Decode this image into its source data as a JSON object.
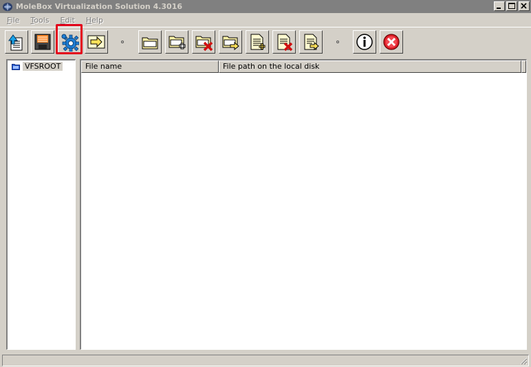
{
  "window": {
    "title": "MoleBox Virtualization Solution 4.3016"
  },
  "menu": {
    "items": [
      {
        "first": "F",
        "rest": "ile"
      },
      {
        "first": "T",
        "rest": "ools"
      },
      {
        "first": "E",
        "rest": "dit"
      },
      {
        "first": "H",
        "rest": "elp"
      }
    ]
  },
  "toolbar": {
    "buttons": [
      "open-project",
      "save-project",
      "settings",
      "build",
      "folder",
      "add-folder",
      "remove-folder",
      "move-folder",
      "add-file",
      "remove-file",
      "move-file",
      "about",
      "exit"
    ],
    "highlighted": "settings",
    "highlight_color": "#e3001b"
  },
  "tree": {
    "root_label": "VFSROOT"
  },
  "list": {
    "columns": [
      "File name",
      "File path on the local disk"
    ]
  },
  "colors": {
    "face": "#d4d0c8",
    "titlebar_inactive": "#808080",
    "accent_red": "#e3001b"
  }
}
